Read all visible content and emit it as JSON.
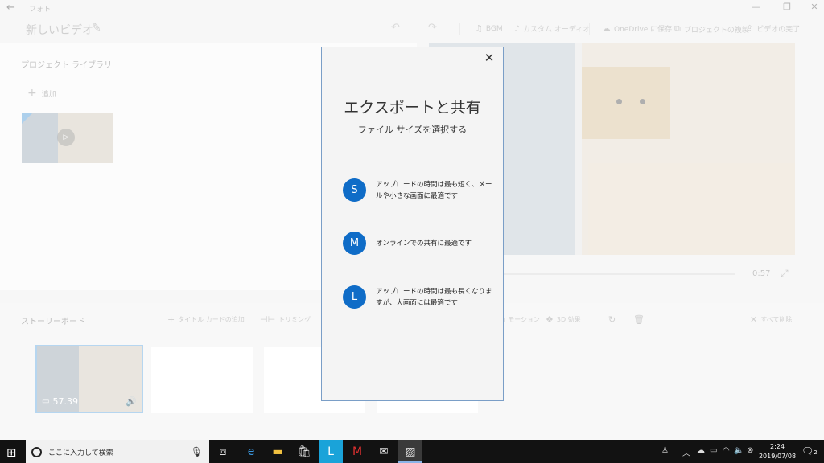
{
  "titlebar": {
    "app_name": "フォト",
    "back_icon": "back-arrow-icon",
    "minimize": "—",
    "maximize": "❐",
    "close": "✕"
  },
  "header": {
    "project_title": "新しいビデオ",
    "buttons": {
      "bgm": "BGM",
      "custom_audio": "カスタム オーディオ",
      "onedrive": "OneDrive に保存",
      "duplicate": "プロジェクトの複製",
      "finish": "ビデオの完了"
    }
  },
  "library": {
    "title": "プロジェクト ライブラリ",
    "add_label": "追加"
  },
  "preview": {
    "time": "0:57"
  },
  "storyboard": {
    "title": "ストーリーボード",
    "buttons": {
      "title_card": "タイトル カードの追加",
      "trim": "トリミング",
      "motion": "モーション",
      "effects_3d": "3D 効果",
      "delete_all": "すべて削除"
    },
    "clip_duration": "57.39"
  },
  "dialog": {
    "title": "エクスポートと共有",
    "subtitle": "ファイル サイズを選択する",
    "close_icon": "close-icon",
    "options": [
      {
        "badge": "S",
        "text": "アップロードの時間は最も短く、メールや小さな画面に最適です"
      },
      {
        "badge": "M",
        "text": "オンラインでの共有に最適です"
      },
      {
        "badge": "L",
        "text": "アップロードの時間は最も長くなりますが、大画面には最適です"
      }
    ],
    "accent": "#0f6cc7"
  },
  "taskbar": {
    "search_placeholder": "ここに入力して検索",
    "clock_time": "2:24",
    "clock_date": "2019/07/08",
    "notification_count": "2"
  }
}
